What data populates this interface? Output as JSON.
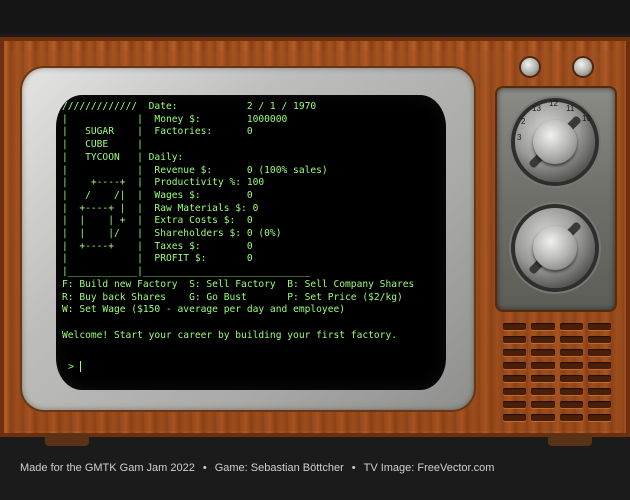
{
  "game": {
    "screen_lines": [
      "/////////////  Date:            2 / 1 / 1970",
      "|            |  Money $:        1000000",
      "|   SUGAR    |  Factories:      0",
      "|   CUBE     |",
      "|   TYCOON   | Daily:",
      "|            |  Revenue $:      0 (100% sales)",
      "|    +----+  |  Productivity %: 100",
      "|   /    /|  |  Wages $:        0",
      "|  +----+ |  |  Raw Materials $: 0",
      "|  |    | +  |  Extra Costs $:  0",
      "|  |    |/   |  Shareholders $: 0 (0%)",
      "|  +----+    |  Taxes $:        0",
      "|            |  PROFIT $:       0",
      "|____________|_____________________________",
      "F: Build new Factory  S: Sell Factory  B: Sell Company Shares",
      "R: Buy back Shares    G: Go Bust       P: Set Price ($2/kg)",
      "W: Set Wage ($150 - average per day and employee)",
      "",
      "Welcome! Start your career by building your first factory."
    ],
    "prompt": ">"
  },
  "dial_top": {
    "numbers": [
      "13",
      "12",
      "11",
      "10",
      "2",
      "3"
    ]
  },
  "footer": {
    "credit_jam": "Made for the GMTK Gam Jam 2022",
    "credit_game": "Game: Sebastian Böttcher",
    "credit_image": "TV Image: FreeVector.com",
    "separator": "•"
  }
}
